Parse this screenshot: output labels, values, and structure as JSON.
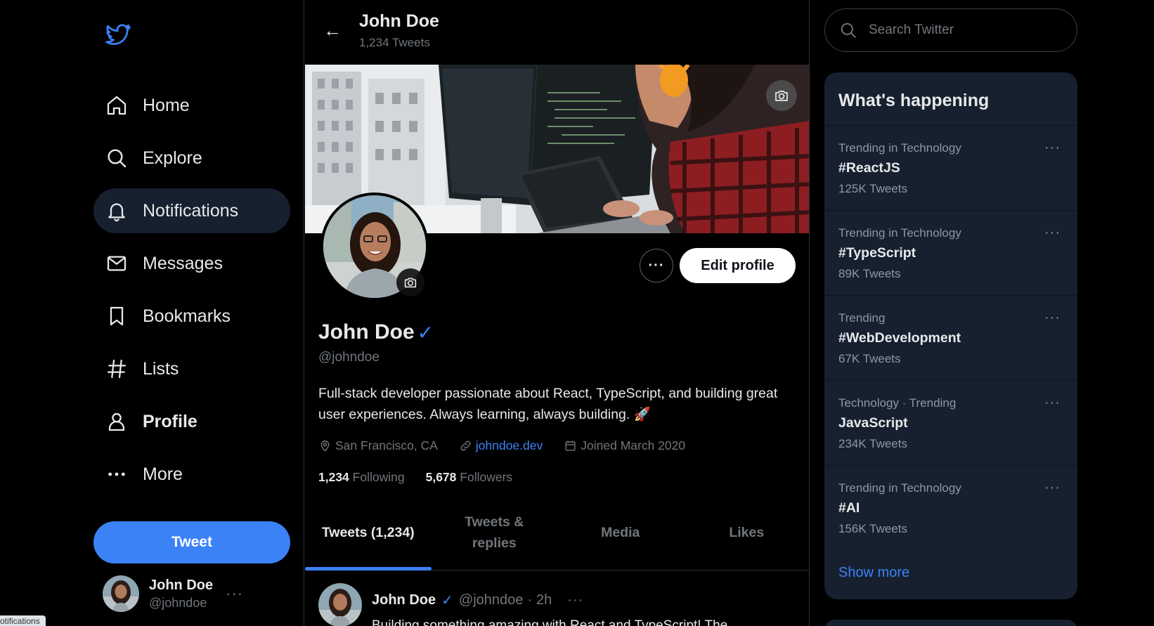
{
  "colors": {
    "accent": "#3b82f6",
    "background": "#000000",
    "panel": "#16202f",
    "muted": "#71767b"
  },
  "nav": {
    "items": [
      {
        "label": "Home",
        "icon": "home-icon"
      },
      {
        "label": "Explore",
        "icon": "search-icon"
      },
      {
        "label": "Notifications",
        "icon": "bell-icon"
      },
      {
        "label": "Messages",
        "icon": "mail-icon"
      },
      {
        "label": "Bookmarks",
        "icon": "bookmark-icon"
      },
      {
        "label": "Lists",
        "icon": "hash-icon"
      },
      {
        "label": "Profile",
        "icon": "user-icon"
      },
      {
        "label": "More",
        "icon": "more-icon"
      }
    ],
    "active": "Notifications",
    "tweet_button": "Tweet"
  },
  "account": {
    "name": "John Doe",
    "handle": "@johndoe",
    "menu": "···"
  },
  "status_tip": "otifications",
  "header": {
    "back": "←",
    "name": "John Doe",
    "tweet_count": "1,234 Tweets"
  },
  "profile": {
    "name": "John Doe",
    "verified": "✓",
    "handle": "@johndoe",
    "bio": "Full-stack developer passionate about React, TypeScript, and building great user experiences. Always learning, always building. 🚀",
    "location": "San Francisco, CA",
    "website": "johndoe.dev",
    "joined": "Joined March 2020",
    "following_count": "1,234",
    "following_label": "Following",
    "followers_count": "5,678",
    "followers_label": "Followers",
    "more_button": "···",
    "edit_button": "Edit profile"
  },
  "tabs": [
    {
      "label": "Tweets (1,234)"
    },
    {
      "label": "Tweets & replies"
    },
    {
      "label": "Media"
    },
    {
      "label": "Likes"
    }
  ],
  "tweet": {
    "name": "John Doe",
    "verified": "✓",
    "handle": "@johndoe",
    "separator": "·",
    "time": "2h",
    "menu": "···",
    "text": "Building something amazing with React and TypeScript! The"
  },
  "search": {
    "placeholder": "Search Twitter"
  },
  "trends": {
    "title": "What's happening",
    "items": [
      {
        "context": "Trending in Technology",
        "tag": "#ReactJS",
        "count": "125K Tweets"
      },
      {
        "context": "Trending in Technology",
        "tag": "#TypeScript",
        "count": "89K Tweets"
      },
      {
        "context": "Trending",
        "tag": "#WebDevelopment",
        "count": "67K Tweets"
      },
      {
        "context": "Technology · Trending",
        "tag": "JavaScript",
        "count": "234K Tweets"
      },
      {
        "context": "Trending in Technology",
        "tag": "#AI",
        "count": "156K Tweets"
      }
    ],
    "more_icon": "···",
    "show_more": "Show more"
  }
}
